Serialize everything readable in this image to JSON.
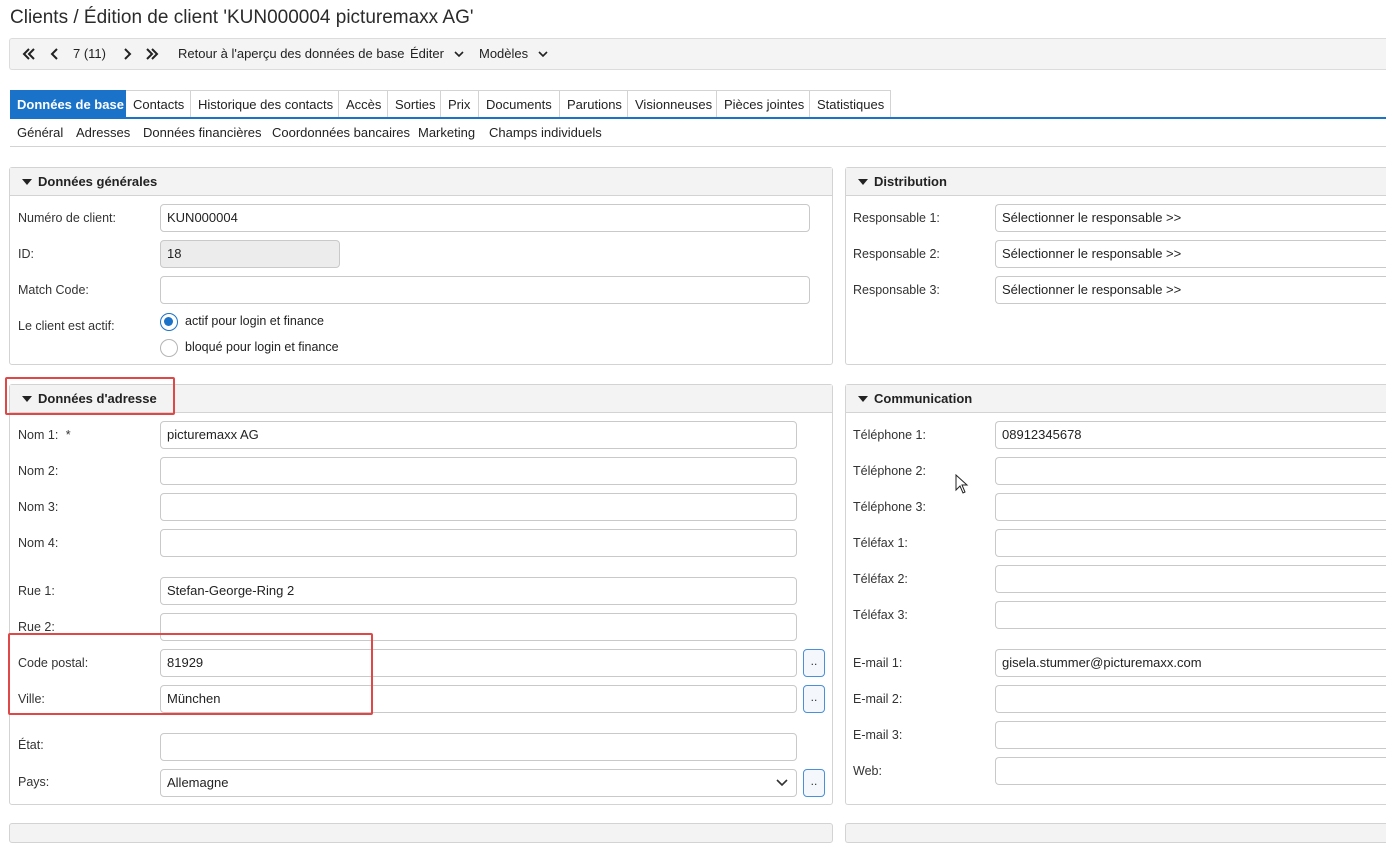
{
  "page_title": "Clients / Édition de client 'KUN000004 picturemaxx AG'",
  "toolbar": {
    "first_icon": "double-chevron-left-icon",
    "prev_icon": "chevron-left-icon",
    "record_position": "7 (11)",
    "next_icon": "chevron-right-icon",
    "last_icon": "double-chevron-right-icon",
    "back_label": "Retour à l'aperçu des données de base",
    "edit_label": "Éditer",
    "templates_label": "Modèles"
  },
  "tabs": [
    "Données de base",
    "Contacts",
    "Historique des contacts",
    "Accès",
    "Sorties",
    "Prix",
    "Documents",
    "Parutions",
    "Visionneuses",
    "Pièces jointes",
    "Statistiques"
  ],
  "subtabs": [
    "Général",
    "Adresses",
    "Données financières",
    "Coordonnées bancaires",
    "Marketing",
    "Champs individuels"
  ],
  "general": {
    "title": "Données générales",
    "client_number_label": "Numéro de client:",
    "client_number": "KUN000004",
    "id_label": "ID:",
    "id": "18",
    "match_code_label": "Match Code:",
    "match_code": "",
    "active_label": "Le client est actif:",
    "radio_active": "actif pour login et finance",
    "radio_blocked": "bloqué pour login et finance",
    "selected": "active"
  },
  "distribution": {
    "title": "Distribution",
    "resp1_label": "Responsable 1:",
    "resp2_label": "Responsable 2:",
    "resp3_label": "Responsable 3:",
    "resp_value": "Sélectionner le responsable >>"
  },
  "address": {
    "title": "Données d'adresse",
    "nom1_label": "Nom 1:",
    "required_mark": "*",
    "nom1": "picturemaxx AG",
    "nom2_label": "Nom 2:",
    "nom2": "",
    "nom3_label": "Nom 3:",
    "nom3": "",
    "nom4_label": "Nom 4:",
    "nom4": "",
    "rue1_label": "Rue 1:",
    "rue1": "Stefan-George-Ring 2",
    "rue2_label": "Rue 2:",
    "rue2": "",
    "postal_label": "Code postal:",
    "postal": "81929",
    "city_label": "Ville:",
    "city": "München",
    "state_label": "État:",
    "state": "",
    "country_label": "Pays:",
    "country": "Allemagne",
    "lookup_button": ".."
  },
  "communication": {
    "title": "Communication",
    "tel1_label": "Téléphone 1:",
    "tel1": "08912345678",
    "tel2_label": "Téléphone 2:",
    "tel2": "",
    "tel3_label": "Téléphone 3:",
    "tel3": "",
    "fax1_label": "Téléfax 1:",
    "fax1": "",
    "fax2_label": "Téléfax 2:",
    "fax2": "",
    "fax3_label": "Téléfax 3:",
    "fax3": "",
    "email1_label": "E-mail 1:",
    "email1": "gisela.stummer@picturemaxx.com",
    "email2_label": "E-mail 2:",
    "email2": "",
    "email3_label": "E-mail 3:",
    "email3": "",
    "web_label": "Web:",
    "web": ""
  },
  "colors": {
    "accent": "#1a73c8",
    "highlight": "#e04848",
    "panel_header": "#f3f3f3",
    "disabled_field": "#ececec"
  }
}
